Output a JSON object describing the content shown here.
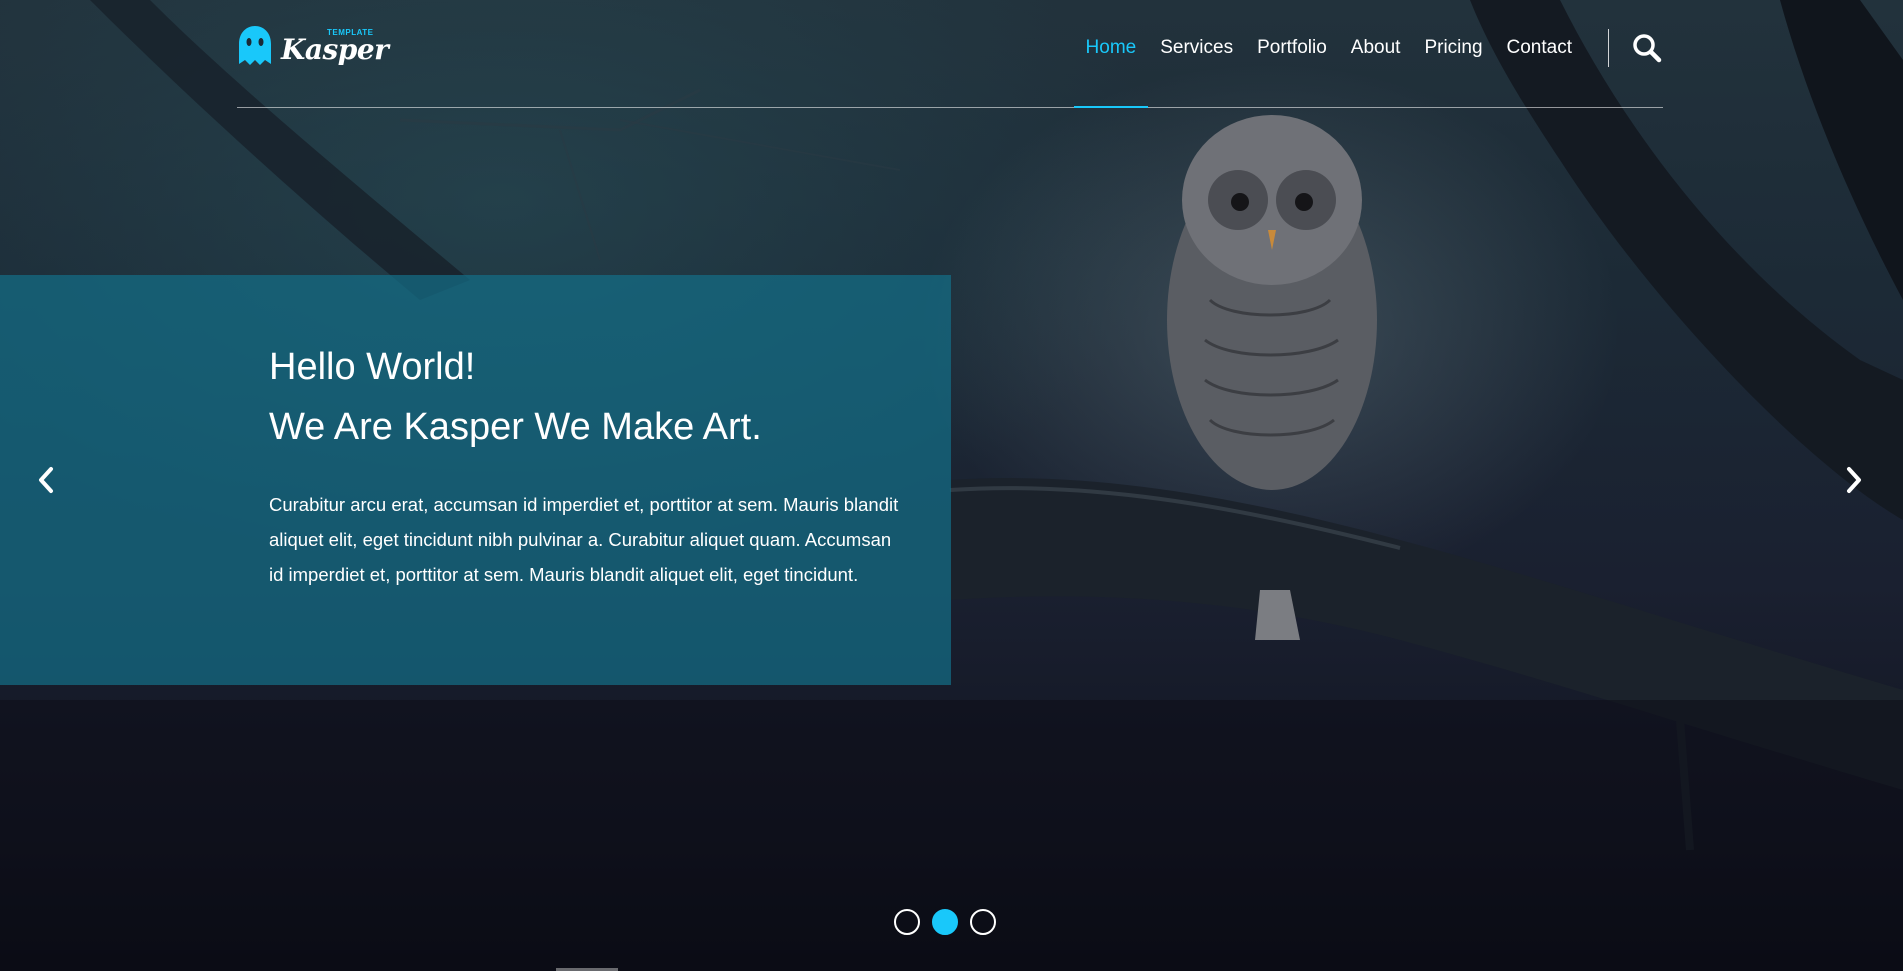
{
  "brand": {
    "name": "Kasper",
    "badge": "TEMPLATE",
    "accent_color": "#19c8fa"
  },
  "nav": {
    "items": [
      {
        "label": "Home",
        "active": true
      },
      {
        "label": "Services",
        "active": false
      },
      {
        "label": "Portfolio",
        "active": false
      },
      {
        "label": "About",
        "active": false
      },
      {
        "label": "Pricing",
        "active": false
      },
      {
        "label": "Contact",
        "active": false
      }
    ],
    "search_icon": "search-icon"
  },
  "slide": {
    "title_line_1": "Hello World!",
    "title_line_2": "We Are Kasper We Make Art.",
    "body": "Curabitur arcu erat, accumsan id imperdiet et, porttitor at sem. Mauris blandit aliquet elit, eget tincidunt nibh pulvinar a. Curabitur aliquet quam. Accumsan id imperdiet et, porttitor at sem. Mauris blandit aliquet elit, eget tincidunt.",
    "panel_color": "#136e87"
  },
  "carousel": {
    "prev_icon": "chevron-left-icon",
    "next_icon": "chevron-right-icon",
    "slide_count": 3,
    "active_index": 1
  }
}
